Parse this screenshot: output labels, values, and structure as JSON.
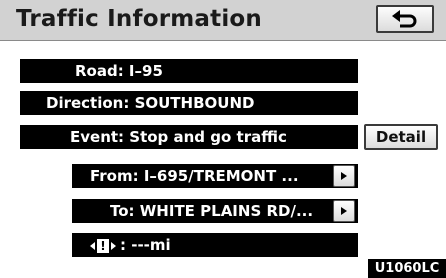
{
  "header": {
    "title": "Traffic Information",
    "back_icon": "return-arrow-icon"
  },
  "info": {
    "road": "Road: I–95",
    "direction": "Direction: SOUTHBOUND",
    "event": "Event: Stop and go traffic",
    "detail_label": "Detail",
    "from": "From: I–695/TREMONT ...",
    "to": "To: WHITE PLAINS RD/...",
    "warning_glyph": "!",
    "distance": ": ‐‐‐mi",
    "arrow_icon": "play-triangle-icon"
  },
  "footer": {
    "code": "U1060LC"
  }
}
